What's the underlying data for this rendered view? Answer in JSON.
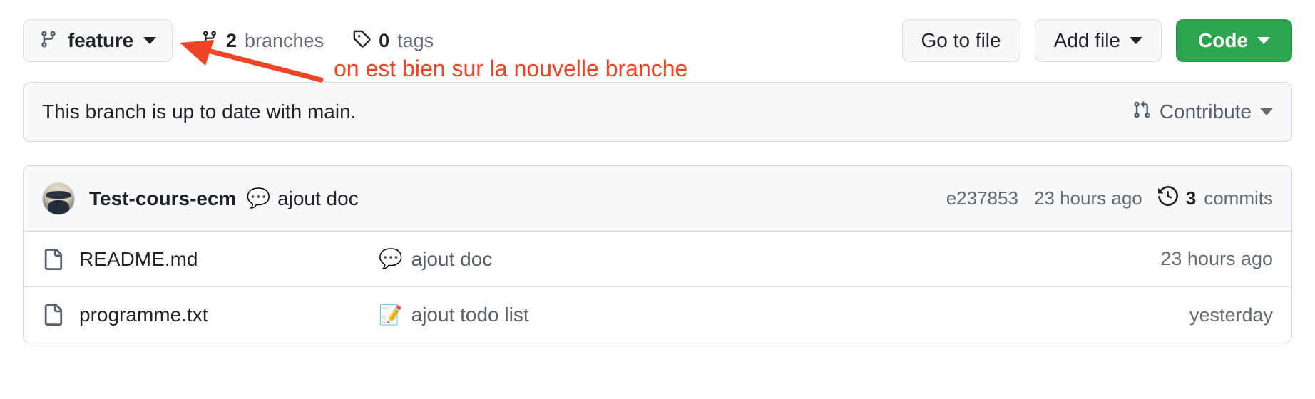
{
  "toolbar": {
    "branch": {
      "name": "feature",
      "icon": "git-branch-icon"
    },
    "branches": {
      "count": "2",
      "label": "branches",
      "icon": "git-branch-icon"
    },
    "tags": {
      "count": "0",
      "label": "tags",
      "icon": "tag-icon"
    },
    "go_to_file_label": "Go to file",
    "add_file_label": "Add file",
    "code_label": "Code"
  },
  "status_panel": {
    "text": "This branch is up to date with main.",
    "contribute_label": "Contribute",
    "contribute_icon": "git-pull-request-icon"
  },
  "commit_header": {
    "author": "Test-cours-ecm",
    "message_emoji": "💬",
    "message": "ajout doc",
    "sha": "e237853",
    "time": "23 hours ago",
    "commits_count": "3",
    "commits_label": "commits",
    "history_icon": "history-icon"
  },
  "files": [
    {
      "icon": "file-icon",
      "name": "README.md",
      "message_emoji": "💬",
      "message": "ajout doc",
      "time": "23 hours ago"
    },
    {
      "icon": "file-icon",
      "name": "programme.txt",
      "message_emoji": "📝",
      "message": "ajout todo list",
      "time": "yesterday"
    }
  ],
  "annotation": {
    "text": "on est bien sur la nouvelle branche",
    "color": "#ee4526"
  },
  "colors": {
    "accent_green": "#2da44e",
    "annotation_red": "#ee4526",
    "panel_bg": "#f6f8fa",
    "border": "#d0d7de",
    "text": "#1f2328",
    "muted_text": "#636c76"
  }
}
